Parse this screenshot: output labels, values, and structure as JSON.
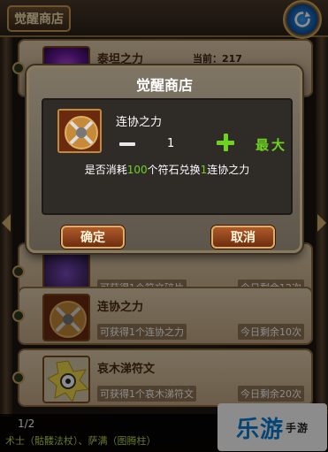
{
  "header": {
    "shop_title": "觉醒商店"
  },
  "list": {
    "items": [
      {
        "name": "泰坦之力",
        "current_label": "当前：217",
        "desc": "",
        "remain": ""
      },
      {
        "name": "",
        "current_label": "",
        "desc": "可获得1个符文碎片",
        "remain": "今日剩余12次"
      },
      {
        "name": "连协之力",
        "current_label": "",
        "desc": "可获得1个连协之力",
        "remain": "今日剩余10次"
      },
      {
        "name": "哀木涕符文",
        "current_label": "",
        "desc": "可获得1个哀木涕符文",
        "remain": "今日剩余20次"
      }
    ]
  },
  "modal": {
    "title": "觉醒商店",
    "item_name": "连协之力",
    "quantity": "1",
    "max_label": "最大",
    "confirm_prefix": "是否消耗",
    "cost": "100",
    "confirm_middle": "个符石兑换",
    "exchange_count": "1",
    "confirm_suffix": "连协之力",
    "ok_label": "确定",
    "cancel_label": "取消"
  },
  "footer": {
    "page": "1/2",
    "ticker": "术士（骷髅法杖）、萨满（图腾柱）"
  },
  "watermark": {
    "main": "乐游",
    "sub": "手游"
  },
  "colors": {
    "accent_green": "#6ed31f",
    "frame_gold": "#c79a52",
    "button_red": "#b05a2a"
  }
}
